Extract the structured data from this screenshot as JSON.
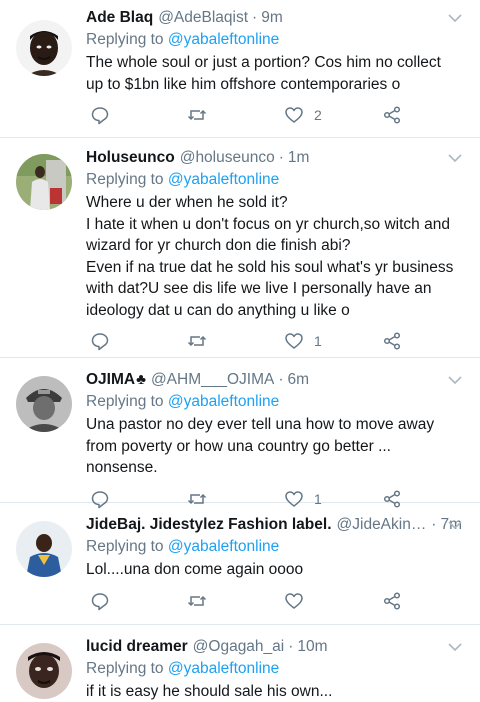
{
  "tweets": [
    {
      "name": "Ade Blaq",
      "handle": "@AdeBlaqist",
      "time": "9m",
      "reply_prefix": "Replying to ",
      "reply_to": "@yabaleftonline",
      "text": "The whole soul or just a portion? Cos him no collect up to $1bn like him offshore contemporaries o",
      "likes": "2"
    },
    {
      "name": "Holuseunco",
      "handle": "@holuseunco",
      "time": "1m",
      "reply_prefix": "Replying to ",
      "reply_to": "@yabaleftonline",
      "text": "Where u der when he sold it?\nI hate it when u don't focus on yr church,so witch and wizard for yr church don die finish abi?\nEven if na true dat he sold his soul what's yr business with dat?U see dis life we live I personally have an ideology dat u can do anything u like o",
      "likes": "1"
    },
    {
      "name": "OJIMA",
      "name_glyph": "♣",
      "handle": "@AHM___OJIMA",
      "time": "6m",
      "reply_prefix": "Replying to ",
      "reply_to": "@yabaleftonline",
      "text": "Una pastor no dey ever tell una how to move away from poverty or how una country go better ... nonsense.",
      "likes": "1"
    },
    {
      "name": "JideBaj. Jidestylez Fashion label.",
      "handle": "@JideAkint...",
      "time": "7m",
      "reply_prefix": "Replying to ",
      "reply_to": "@yabaleftonline",
      "text": "Lol....una don come again oooo",
      "likes": ""
    },
    {
      "name": "lucid dreamer",
      "handle": "@Ogagah_ai",
      "time": "10m",
      "reply_prefix": "Replying to ",
      "reply_to": "@yabaleftonline",
      "text": "if it is easy he should sale his own...",
      "likes": ""
    }
  ],
  "icons": {
    "reply": "reply-icon",
    "retweet": "retweet-icon",
    "like": "heart-icon",
    "share": "share-icon",
    "menu": "chevron-down-icon"
  },
  "colors": {
    "link": "#1da1f2",
    "secondary": "#657786",
    "divider": "#e1e8ed"
  }
}
